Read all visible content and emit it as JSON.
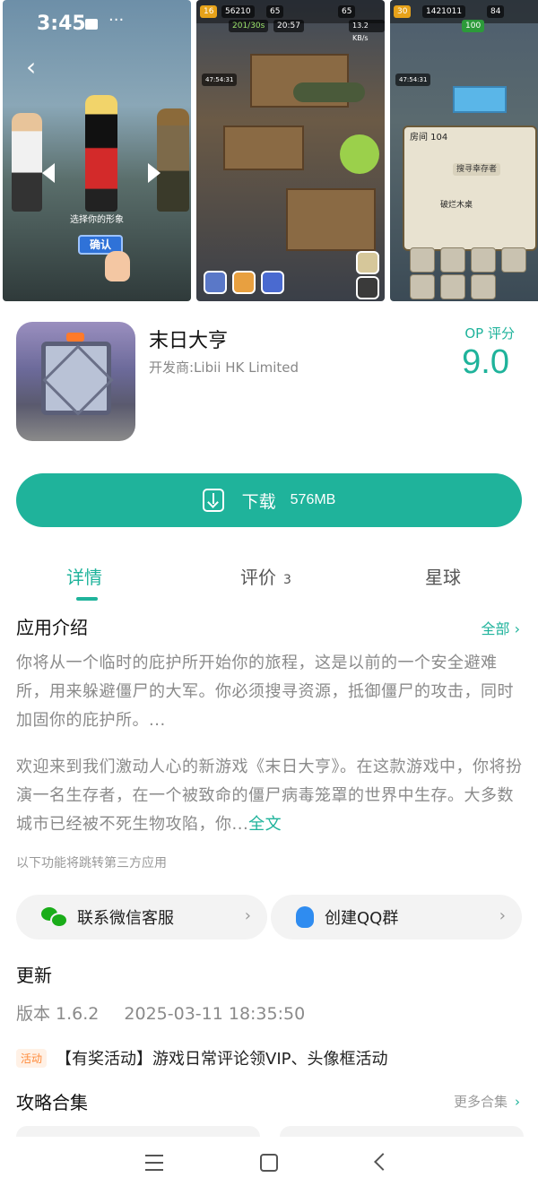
{
  "screenshots": {
    "shot1": {
      "status_time": "3:45",
      "choose_label": "选择你的形象",
      "confirm_label": "确认"
    },
    "shot2": {
      "hud_level": "16",
      "hud_coins": "56210",
      "hud_energy": "65",
      "hud_gems": "65",
      "hud_progress": "201/30s",
      "hud_time": "20:57",
      "hud_speed": "13.2 KB/s",
      "hud_timer": "47:54:31"
    },
    "shot3": {
      "hud_level": "30",
      "hud_coins": "1421011",
      "hud_energy": "84",
      "hud_score": "100",
      "hud_timer": "47:54:31",
      "room_label": "房间 104",
      "item_name": "破烂木桌",
      "search_button": "搜寻幸存者"
    }
  },
  "app": {
    "name": "末日大亨",
    "developer": "开发商:Libii HK Limited",
    "score_label": "OP 评分",
    "score_value": "9.0"
  },
  "download": {
    "label": "下载",
    "size": "576MB"
  },
  "tabs": {
    "detail": "详情",
    "review": "评价",
    "review_count": "3",
    "planet": "星球"
  },
  "intro": {
    "title": "应用介绍",
    "all_link": "全部 ›",
    "paragraph1": "你将从一个临时的庇护所开始你的旅程，这是以前的一个安全避难所，用来躲避僵尸的大军。你必须搜寻资源，抵御僵尸的攻击，同时加固你的庇护所。...",
    "paragraph2": "欢迎来到我们激动人心的新游戏《末日大亨》。在这款游戏中，你将扮演一名生存者，在一个被致命的僵尸病毒笼罩的世界中生存。大多数城市已经被不死生物攻陷，你...",
    "full_text_link": "全文",
    "third_party_note": "以下功能将跳转第三方应用"
  },
  "contacts": {
    "wechat": "联系微信客服",
    "qq": "创建QQ群"
  },
  "update": {
    "title": "更新",
    "version": "版本 1.6.2",
    "date": "2025-03-11 18:35:50"
  },
  "activity": {
    "badge": "活动",
    "text": "【有奖活动】游戏日常评论领VIP、头像框活动"
  },
  "guides": {
    "title": "攻略合集",
    "more_link": "更多合集"
  },
  "colors": {
    "accent": "#1fb39b",
    "text_primary": "#111111",
    "text_secondary": "#8a8a8a",
    "badge_orange": "#ff8a3a",
    "wechat_green": "#1aad19",
    "qq_blue": "#2f8cf0"
  }
}
